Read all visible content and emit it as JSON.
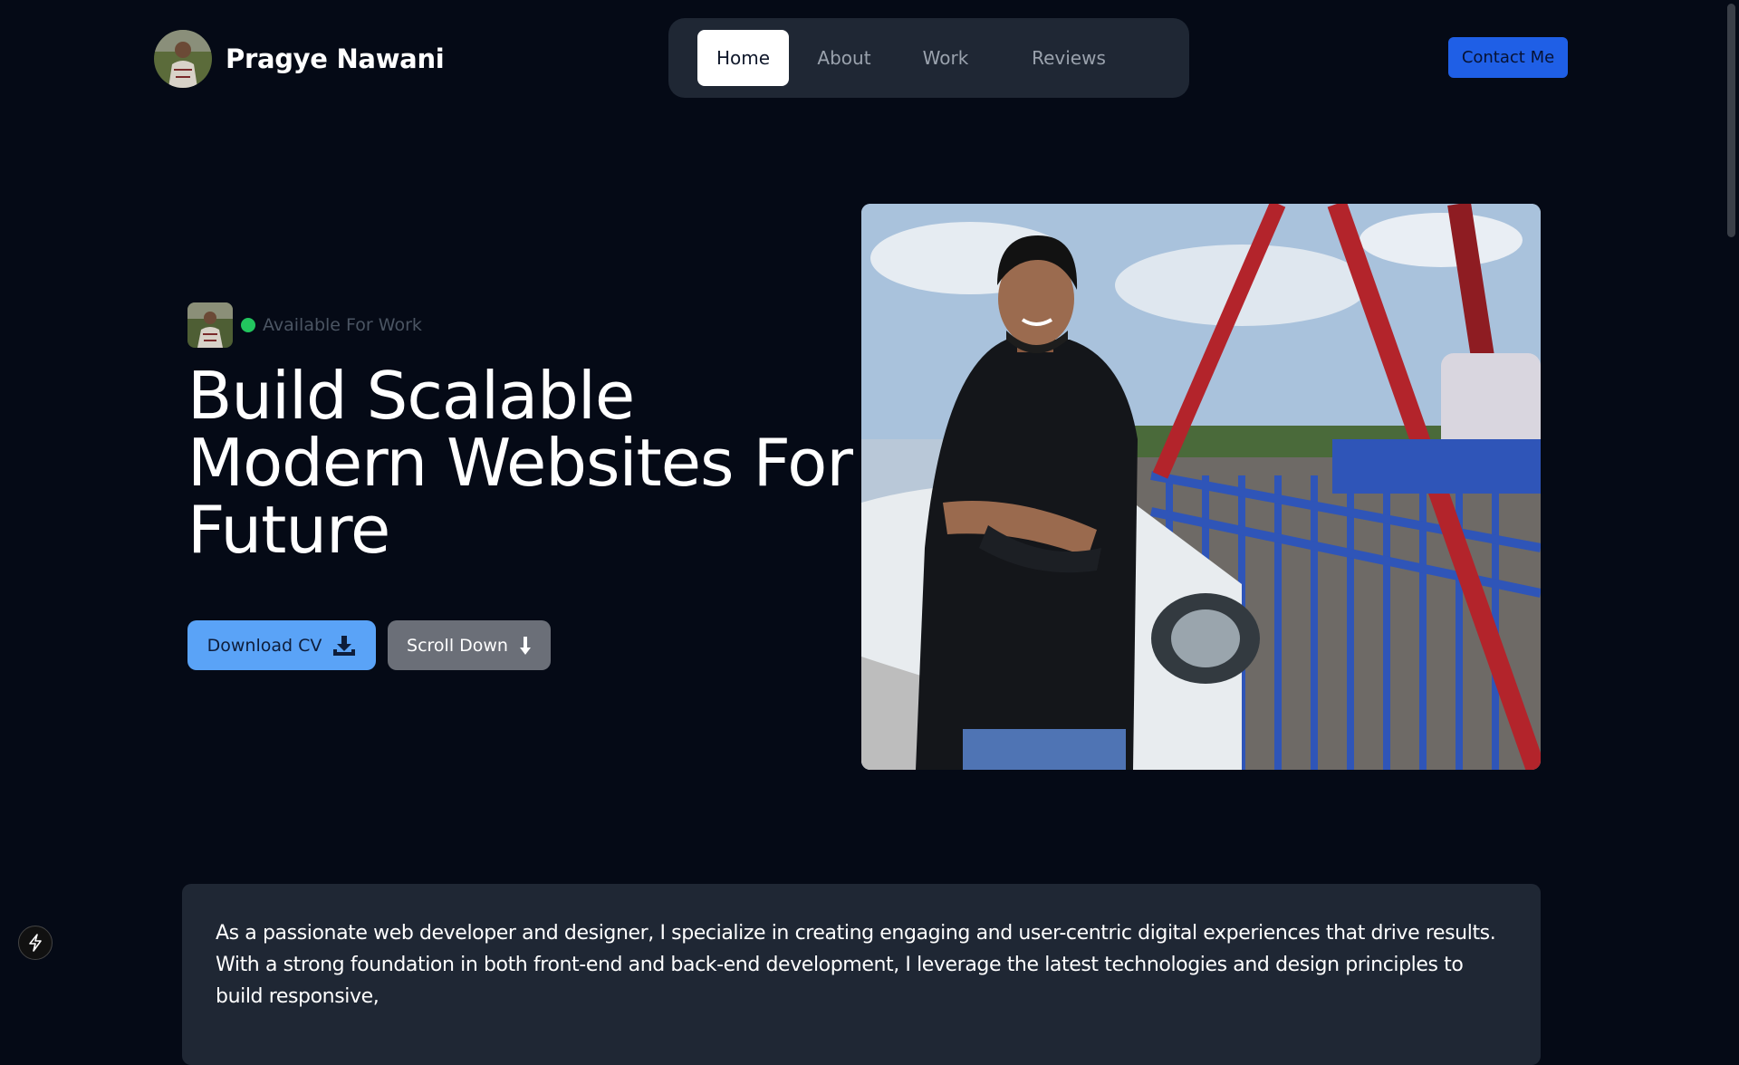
{
  "header": {
    "brand_name": "Pragye Nawani",
    "nav": [
      "Home",
      "About",
      "Work",
      "Reviews"
    ],
    "active_nav": "Home",
    "contact_label": "Contact Me"
  },
  "hero": {
    "status_text": "Available For Work",
    "headline": "Build Scalable Modern Websites For Future",
    "download_label": "Download CV",
    "scroll_label": "Scroll Down"
  },
  "about": {
    "text": "As a passionate web developer and designer, I specialize in creating engaging and user-centric digital experiences that drive results. With a strong foundation in both front-end and back-end development, I leverage the latest technologies and design principles to build responsive,"
  },
  "colors": {
    "background": "#050a16",
    "nav_bg": "#1f2734",
    "accent_blue": "#1f5fe6",
    "download_blue": "#5aa3f7",
    "status_green": "#22c55e"
  },
  "icons": [
    "download-icon",
    "arrow-down-icon",
    "bolt-icon"
  ]
}
